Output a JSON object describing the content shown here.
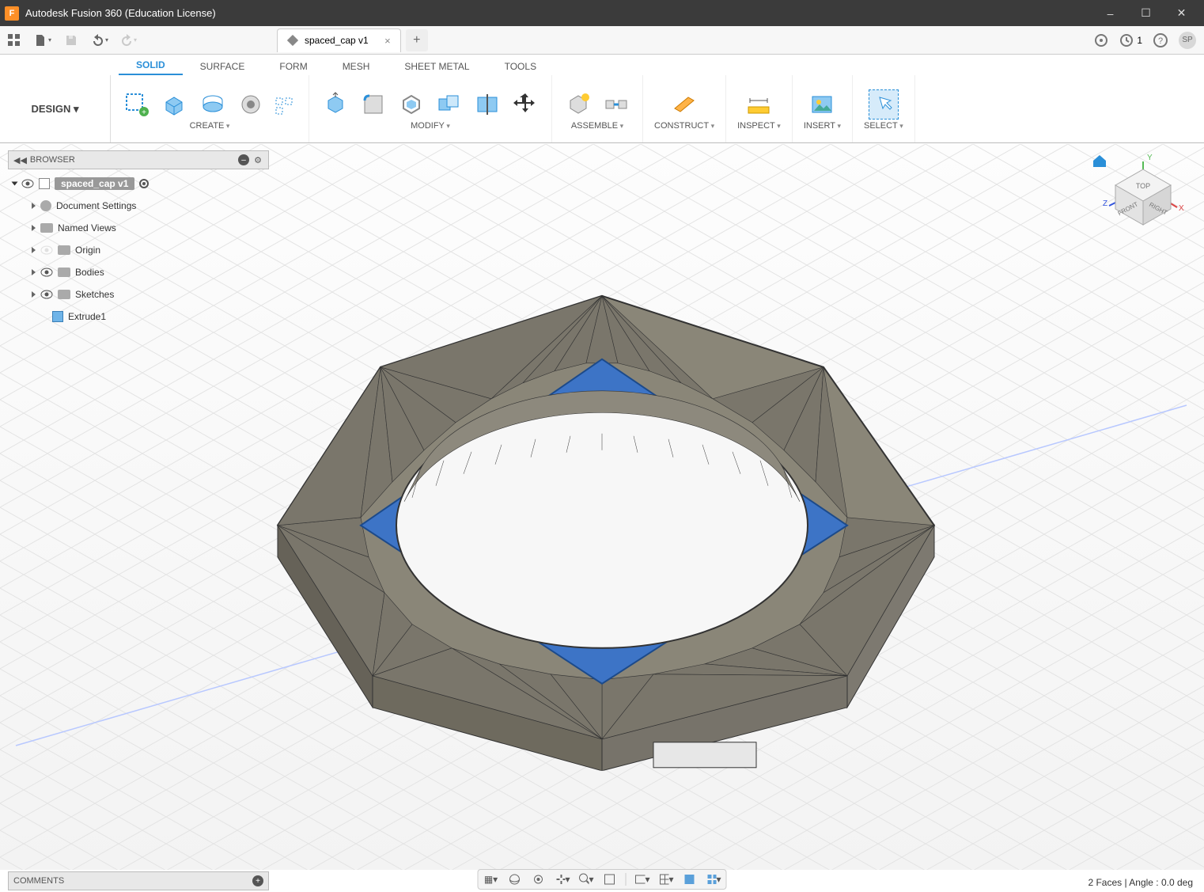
{
  "app": {
    "title": "Autodesk Fusion 360 (Education License)",
    "icon_letter": "F"
  },
  "qat": {
    "data_panel": "data-panel",
    "file": "file",
    "save": "save",
    "undo": "undo",
    "redo": "redo"
  },
  "document_tab": {
    "label": "spaced_cap v1"
  },
  "header_right": {
    "job_count": "1",
    "user_initials": "SP"
  },
  "workspace": {
    "label": "DESIGN"
  },
  "ribbon_tabs": [
    "SOLID",
    "SURFACE",
    "FORM",
    "MESH",
    "SHEET METAL",
    "TOOLS"
  ],
  "ribbon_active_tab_index": 0,
  "ribbon_groups": [
    {
      "label": "CREATE",
      "icons": [
        "sketch",
        "extrude",
        "revolve",
        "loft",
        "rect-pattern"
      ]
    },
    {
      "label": "MODIFY",
      "icons": [
        "press-pull",
        "fillet",
        "shell",
        "combine",
        "split",
        "move"
      ]
    },
    {
      "label": "ASSEMBLE",
      "icons": [
        "new-component",
        "joint"
      ]
    },
    {
      "label": "CONSTRUCT",
      "icons": [
        "plane"
      ]
    },
    {
      "label": "INSPECT",
      "icons": [
        "measure"
      ]
    },
    {
      "label": "INSERT",
      "icons": [
        "decal"
      ]
    },
    {
      "label": "SELECT",
      "icons": [
        "select-box"
      ]
    }
  ],
  "browser": {
    "header": "BROWSER",
    "root": "spaced_cap v1",
    "items": [
      {
        "label": "Document Settings",
        "icon": "gear",
        "visible": true
      },
      {
        "label": "Named Views",
        "icon": "folder",
        "visible": true
      },
      {
        "label": "Origin",
        "icon": "folder",
        "visible": false
      },
      {
        "label": "Bodies",
        "icon": "folder",
        "visible": true
      },
      {
        "label": "Sketches",
        "icon": "folder",
        "visible": true
      }
    ],
    "timeline_feature": "Extrude1"
  },
  "viewcube": {
    "faces": {
      "top": "TOP",
      "front": "FRONT",
      "right": "RIGHT"
    },
    "axes": {
      "x": "X",
      "y": "Y",
      "z": "Z"
    }
  },
  "comments": {
    "header": "COMMENTS"
  },
  "status": {
    "text": "2 Faces | Angle : 0.0 deg"
  },
  "nav_toolbar": [
    "orbit-menu",
    "orbit",
    "look",
    "pan",
    "zoom",
    "fit",
    "sep",
    "display",
    "grid",
    "viewports",
    "multi"
  ]
}
